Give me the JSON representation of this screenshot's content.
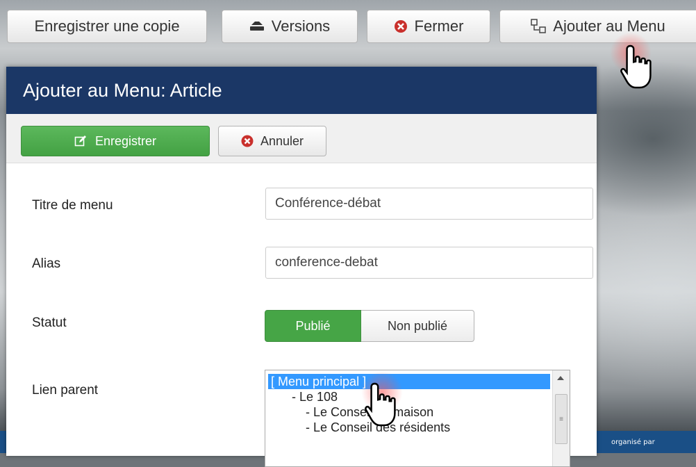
{
  "toolbar": {
    "save_copy": "Enregistrer une copie",
    "versions": "Versions",
    "close": "Fermer",
    "add_menu": "Ajouter au Menu"
  },
  "modal": {
    "title": "Ajouter au Menu: Article",
    "save": "Enregistrer",
    "cancel": "Annuler",
    "fields": {
      "menu_title_label": "Titre de menu",
      "menu_title_value": "Conférence-débat",
      "alias_label": "Alias",
      "alias_value": "conference-debat",
      "status_label": "Statut",
      "status_on": "Publié",
      "status_off": "Non publié",
      "parent_label": "Lien parent"
    },
    "parent_options": [
      "[ Menu principal ]",
      "- Le 108",
      "- Le Conseil de maison",
      "- Le Conseil des résidents"
    ]
  },
  "footer": {
    "text": "organisé par"
  },
  "colors": {
    "header": "#1b3766",
    "success": "#46a546",
    "selection": "#3399ff",
    "danger": "#c9302c"
  }
}
